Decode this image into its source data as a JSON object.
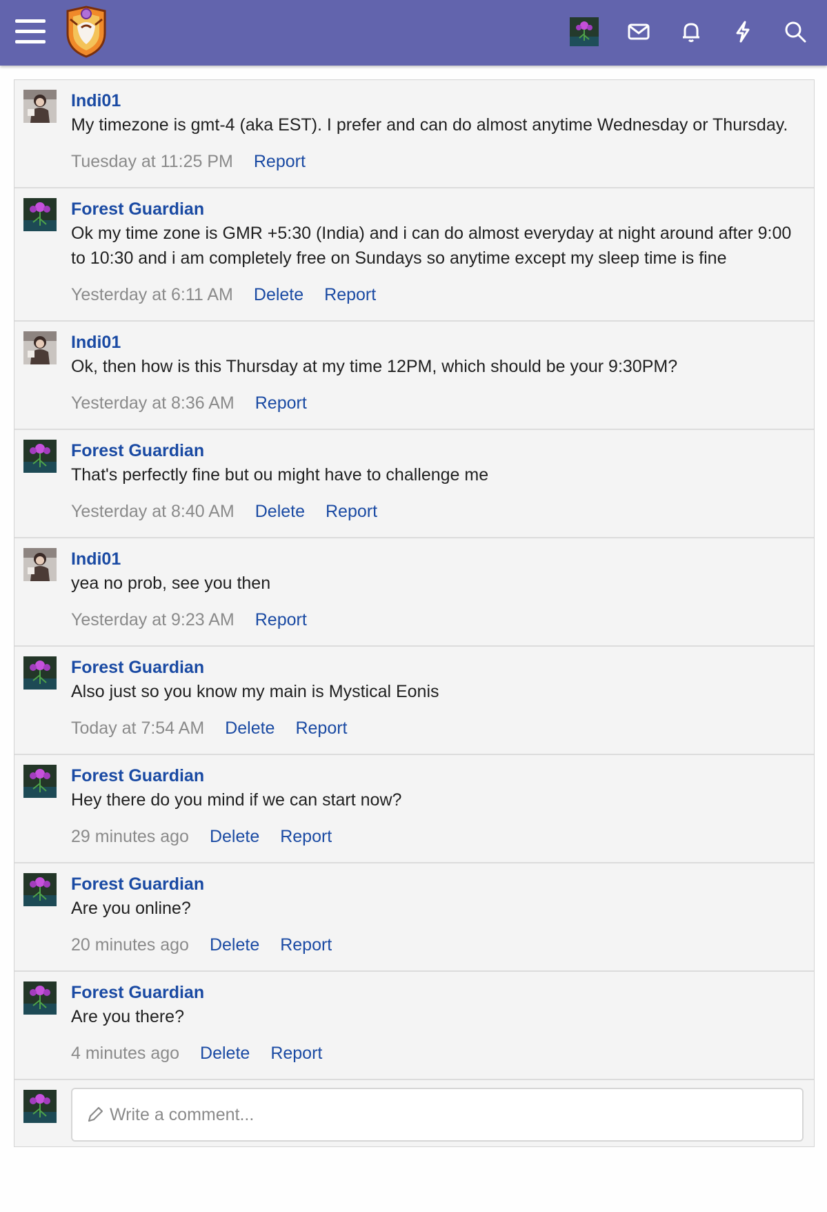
{
  "header": {
    "menu_icon": "hamburger-menu-icon",
    "logo_icon": "site-logo",
    "icons": [
      "user-avatar",
      "envelope-icon",
      "bell-icon",
      "lightning-icon",
      "search-icon"
    ]
  },
  "messages": [
    {
      "author": "Indi01",
      "text": "My timezone is gmt-4 (aka EST). I prefer and can do almost anytime Wednesday or Thursday.",
      "time": "Tuesday at 11:25 PM",
      "delete": "",
      "report": "Report"
    },
    {
      "author": "Forest Guardian",
      "text": "Ok my time zone is GMR +5:30 (India) and i can do almost everyday at night around after 9:00 to 10:30 and i am completely free on Sundays so anytime except my sleep time is fine",
      "time": "Yesterday at 6:11 AM",
      "delete": "Delete",
      "report": "Report"
    },
    {
      "author": "Indi01",
      "text": "Ok, then how is this Thursday at my time 12PM, which should be your 9:30PM?",
      "time": "Yesterday at 8:36 AM",
      "delete": "",
      "report": "Report"
    },
    {
      "author": "Forest Guardian",
      "text": "That's perfectly fine but ou might have to challenge me",
      "time": "Yesterday at 8:40 AM",
      "delete": "Delete",
      "report": "Report"
    },
    {
      "author": "Indi01",
      "text": "yea no prob, see you then",
      "time": "Yesterday at 9:23 AM",
      "delete": "",
      "report": "Report"
    },
    {
      "author": "Forest Guardian",
      "text": "Also just so you know my main is Mystical Eonis",
      "time": "Today at 7:54 AM",
      "delete": "Delete",
      "report": "Report"
    },
    {
      "author": "Forest Guardian",
      "text": "Hey there do you mind if we can start now?",
      "time": "29 minutes ago",
      "delete": "Delete",
      "report": "Report"
    },
    {
      "author": "Forest Guardian",
      "text": "Are you online?",
      "time": "20 minutes ago",
      "delete": "Delete",
      "report": "Report"
    },
    {
      "author": "Forest Guardian",
      "text": "Are you there?",
      "time": "4 minutes ago",
      "delete": "Delete",
      "report": "Report"
    }
  ],
  "comment": {
    "placeholder": "Write a comment..."
  }
}
